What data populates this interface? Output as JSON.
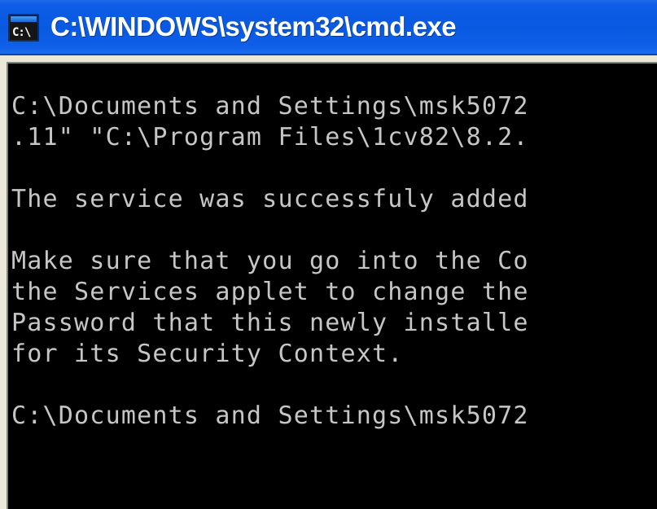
{
  "window": {
    "title": "C:\\WINDOWS\\system32\\cmd.exe",
    "icon_name": "cmd-console-icon",
    "icon_glyph": "C:\\",
    "titlebar_color": "#0A59E2",
    "frame_color": "#ECE9D8",
    "console_bg": "#000000",
    "console_fg": "#C6C6C6"
  },
  "console": {
    "lines": [
      {
        "text": "C:\\Documents and Settings\\msk5072",
        "blank": false
      },
      {
        "text": ".11\" \"C:\\Program Files\\1cv82\\8.2.",
        "blank": false
      },
      {
        "text": "",
        "blank": true
      },
      {
        "text": "The service was successfuly added",
        "blank": false
      },
      {
        "text": "",
        "blank": true
      },
      {
        "text": "Make sure that you go into the Co",
        "blank": false
      },
      {
        "text": "the Services applet to change the",
        "blank": false
      },
      {
        "text": "Password that this newly installe",
        "blank": false
      },
      {
        "text": "for its Security Context.",
        "blank": false
      },
      {
        "text": "",
        "blank": true
      },
      {
        "text": "C:\\Documents and Settings\\msk5072",
        "blank": false
      },
      {
        "text": "",
        "blank": true
      },
      {
        "text": "",
        "blank": true
      }
    ]
  }
}
